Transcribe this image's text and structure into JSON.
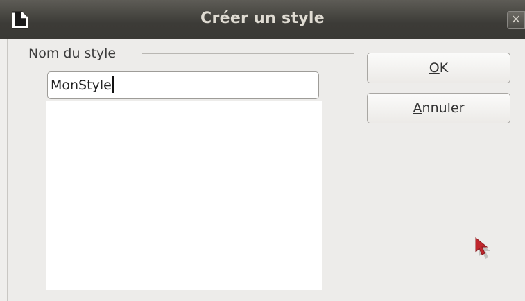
{
  "window": {
    "title": "Créer un style",
    "close_glyph": "×"
  },
  "form": {
    "group_label": "Nom du style",
    "style_name_value": "MonStyle"
  },
  "buttons": {
    "ok_mnemonic": "O",
    "ok_rest": "K",
    "cancel_mnemonic": "A",
    "cancel_rest": "nnuler"
  },
  "colors": {
    "titlebar": "#3c3b37",
    "title_text": "#dfdbd2",
    "dialog_bg": "#efeeec",
    "cursor": "#c0272d"
  },
  "icons": {
    "app": "document-icon",
    "close": "close-icon",
    "pointer": "mouse-pointer-icon"
  }
}
